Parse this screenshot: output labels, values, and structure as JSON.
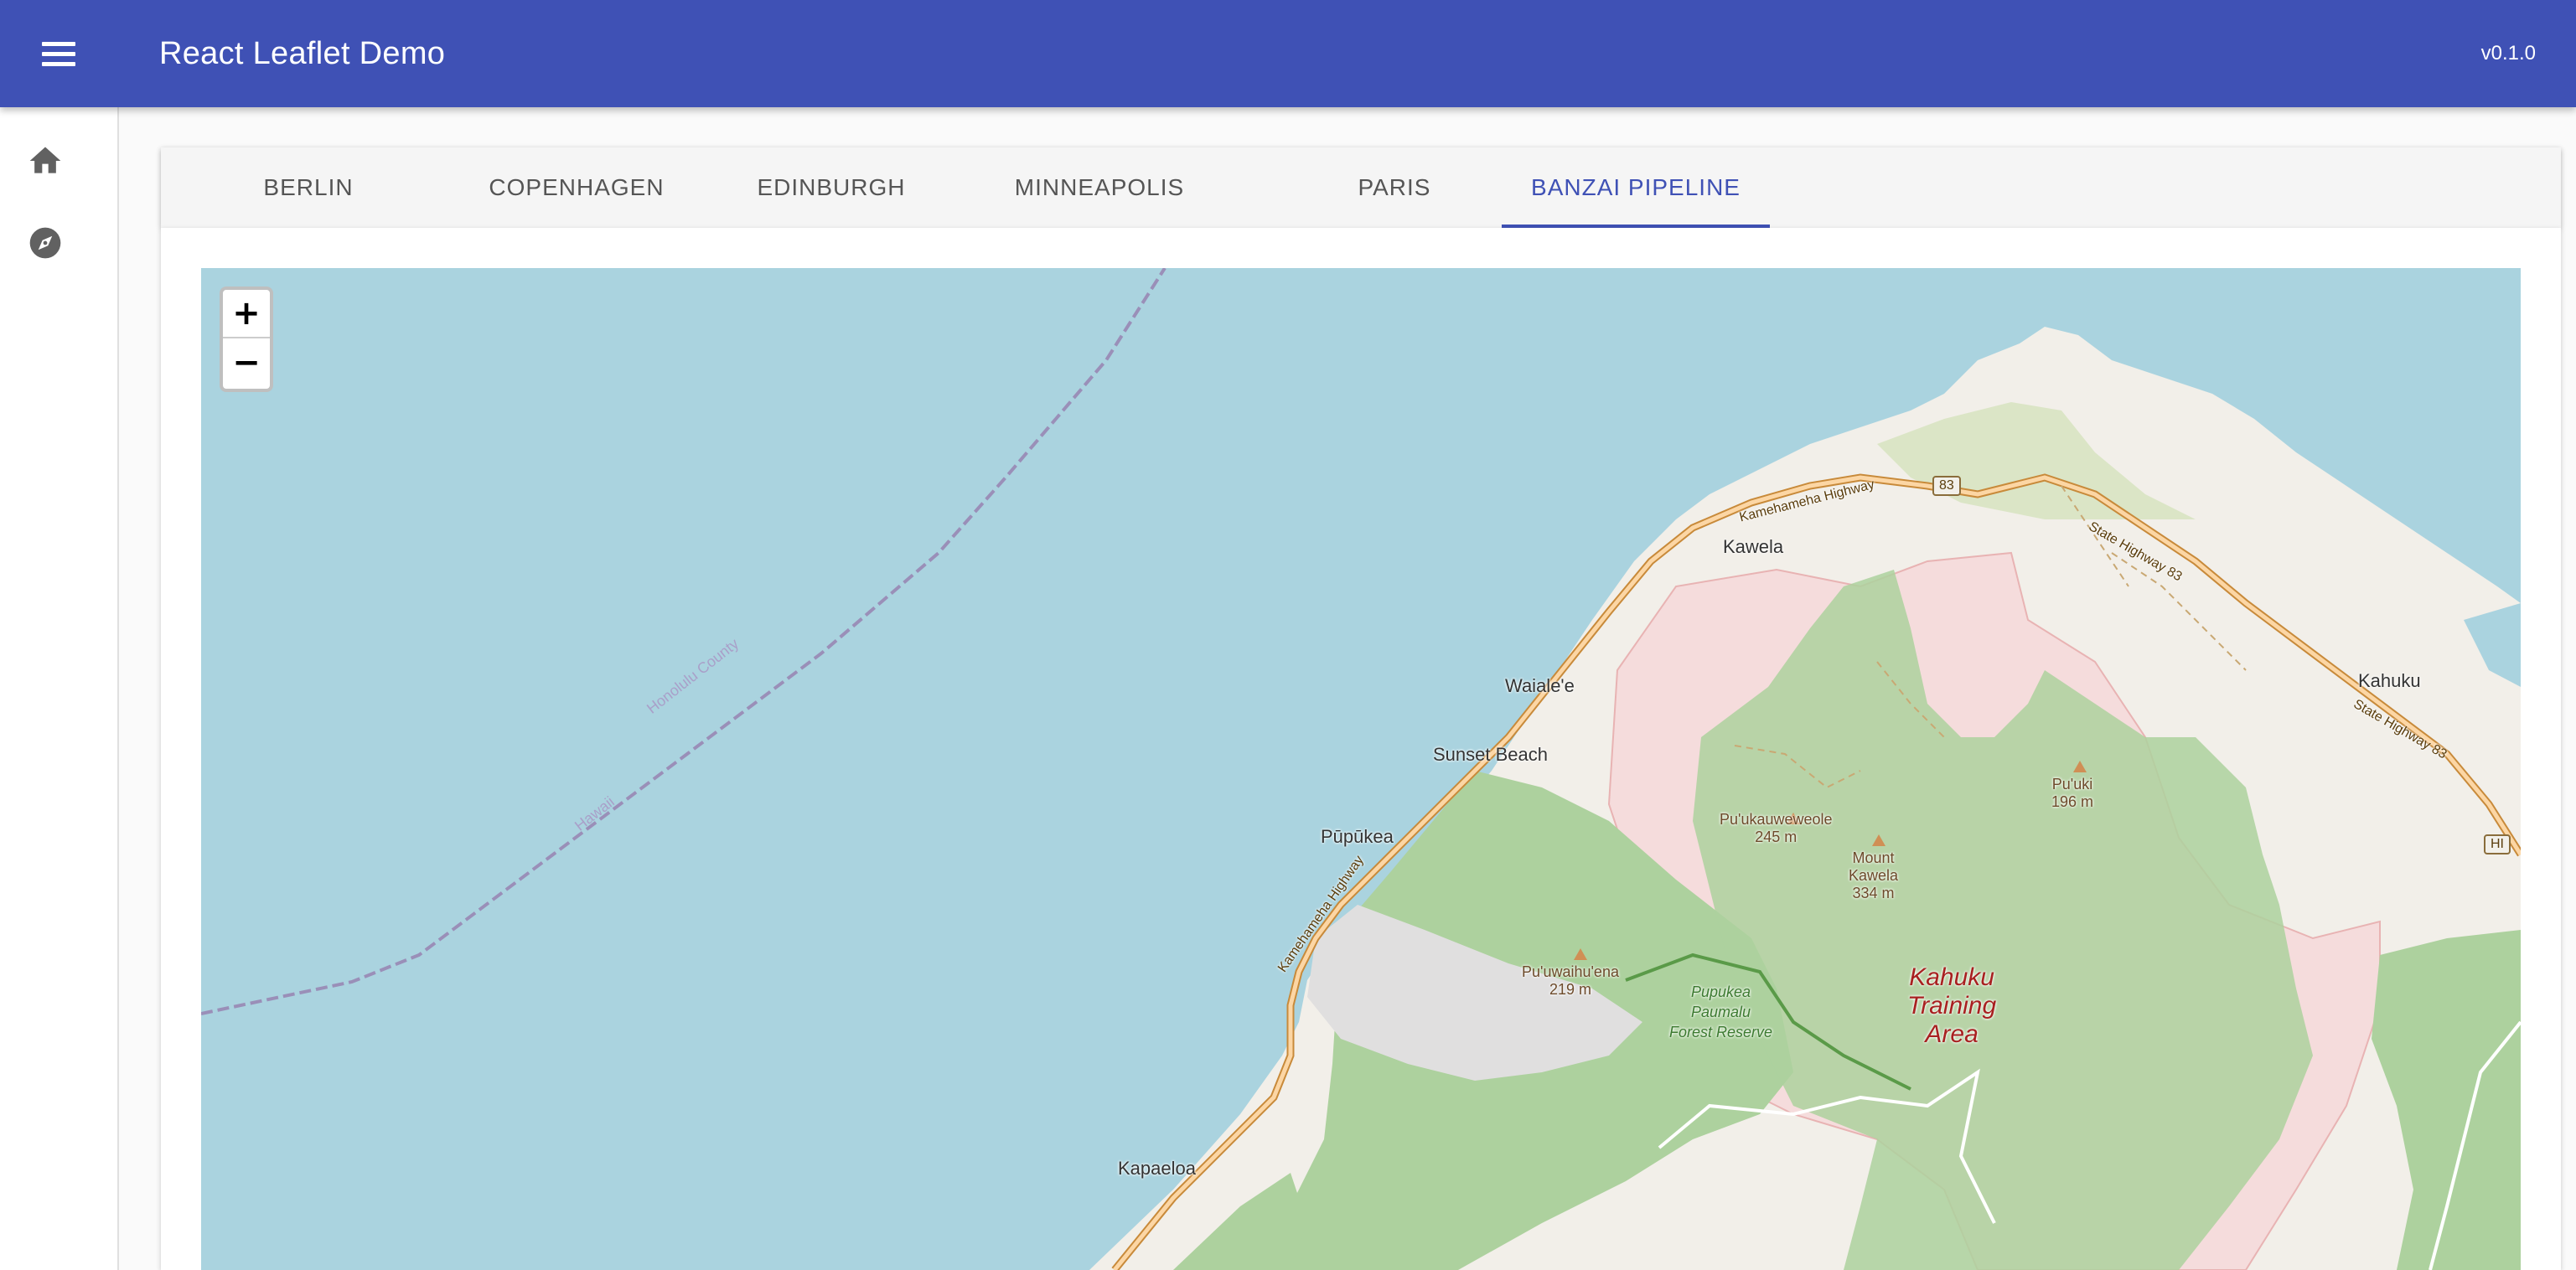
{
  "header": {
    "title": "React Leaflet Demo",
    "version": "v0.1.0"
  },
  "sidebar": {
    "items": [
      {
        "icon": "home-icon"
      },
      {
        "icon": "explore-icon"
      }
    ]
  },
  "tabs": [
    {
      "label": "BERLIN",
      "active": false
    },
    {
      "label": "COPENHAGEN",
      "active": false
    },
    {
      "label": "EDINBURGH",
      "active": false
    },
    {
      "label": "MINNEAPOLIS",
      "active": false
    },
    {
      "label": "PARIS",
      "active": false
    },
    {
      "label": "BANZAI PIPELINE",
      "active": true
    }
  ],
  "map": {
    "zoom_in": "+",
    "zoom_out": "−",
    "labels": {
      "kawela": "Kawela",
      "waialee": "Waiale'e",
      "sunset_beach": "Sunset Beach",
      "pupukea": "Pūpūkea",
      "kapaeloa": "Kapaeloa",
      "kahuku": "Kahuku",
      "puuki_name": "Pu'uki",
      "puuki_elev": "196 m",
      "puukauweweole_name": "Pu'ukauweweole",
      "puukauweweole_elev": "245 m",
      "mount_kawela_1": "Mount",
      "mount_kawela_2": "Kawela",
      "mount_kawela_elev": "334 m",
      "puuwaihuena_name": "Pu'uwaihu'ena",
      "puuwaihuena_elev": "219 m",
      "forest_1": "Pupukea",
      "forest_2": "Paumalu",
      "forest_3": "Forest Reserve",
      "training_1": "Kahuku",
      "training_2": "Training",
      "training_3": "Area",
      "county_1": "Honolulu County",
      "county_2": "Hawaii",
      "road_1": "Kamehameha Highway",
      "road_2": "State Highway 83",
      "road_3": "State Highway 83",
      "road_4": "Kamehameha Highway",
      "shield_83": "83",
      "shield_hi": "HI"
    }
  },
  "colors": {
    "appbar": "#3f51b5",
    "water": "#aad3df",
    "land": "#f2efe9",
    "forest": "#add19e",
    "military": "#f5dcdc",
    "road": "#f9b26a"
  }
}
